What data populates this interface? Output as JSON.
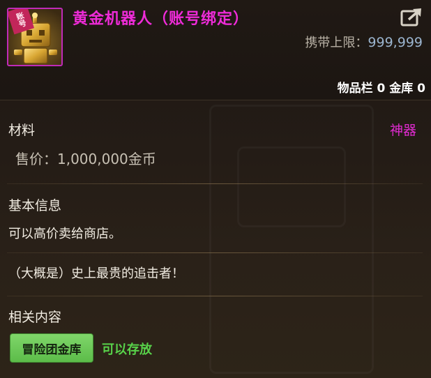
{
  "item": {
    "name": "黄金机器人（账号绑定）",
    "bound_tag": "账号",
    "icon": "golden-robot-icon",
    "carry_limit_label": "携带上限：",
    "carry_limit_value": "999,999",
    "storage_text": "物品栏 0 金库 0"
  },
  "details": {
    "category": "材料",
    "rarity": "神器",
    "price": "售价：1,000,000金币"
  },
  "basic_info": {
    "title": "基本信息",
    "description": "可以高价卖给商店。",
    "flavor": "（大概是）史上最贵的追击者！"
  },
  "related": {
    "title": "相关内容",
    "tag_label": "冒险团金库",
    "tag_note": "可以存放"
  },
  "colors": {
    "item_name": "#ee2bd8",
    "rarity": "#e22bd2",
    "related_note": "#58d24a",
    "tag_button": "#6cc957"
  }
}
